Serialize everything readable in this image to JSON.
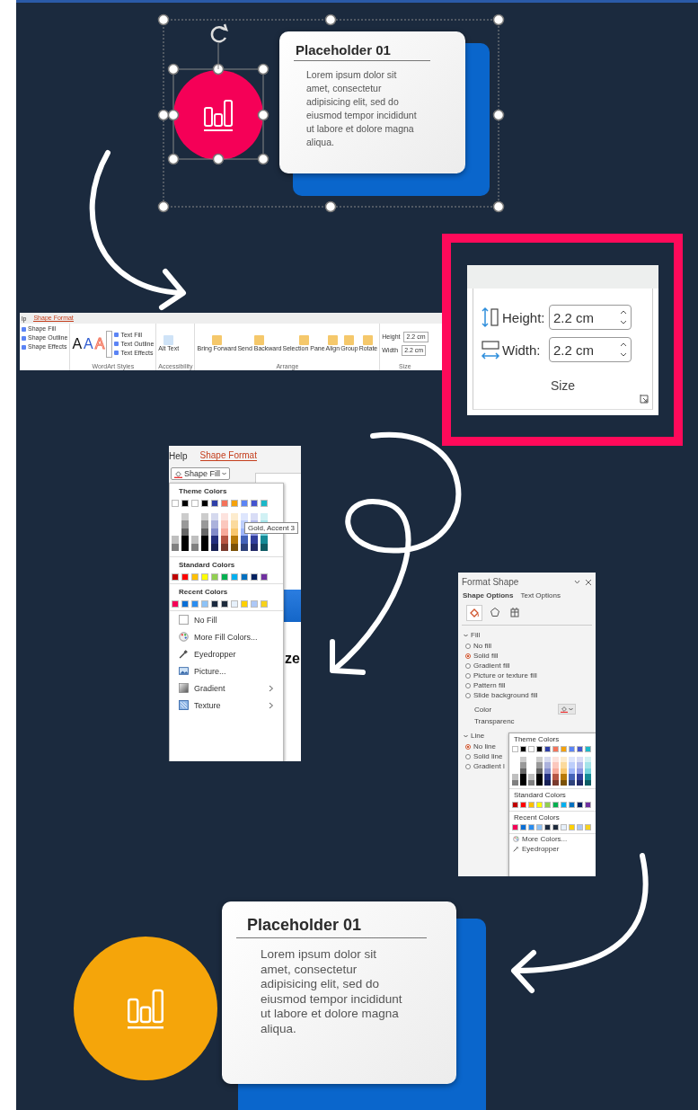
{
  "top_graphic": {
    "title": "Placeholder 01",
    "body": "Lorem ipsum dolor sit amet, consectetur adipisicing elit, sed do eiusmod tempor incididunt ut labore et dolore magna aliqua."
  },
  "ribbon": {
    "tabs": [
      {
        "label": "lp",
        "selected": false
      },
      {
        "label": "Shape Format",
        "selected": true
      }
    ],
    "shape_commands": [
      "Shape Fill",
      "Shape Outline",
      "Shape Effects"
    ],
    "wordart_letters": [
      "A",
      "A",
      "A"
    ],
    "text_commands": [
      "Text Fill",
      "Text Outline",
      "Text Effects"
    ],
    "alt_text": "Alt Text",
    "arrange_commands": [
      "Bring Forward",
      "Send Backward",
      "Selection Pane",
      "Align",
      "Group",
      "Rotate"
    ],
    "size_fields": [
      {
        "label": "Height",
        "value": "2.2 cm"
      },
      {
        "label": "Width",
        "value": "2.2 cm"
      }
    ],
    "group_labels": [
      "WordArt Styles",
      "Accessibility",
      "Arrange",
      "Size"
    ]
  },
  "size_panel": {
    "fields": [
      {
        "kind": "height",
        "label": "Height:",
        "value": "2.2 cm"
      },
      {
        "kind": "width",
        "label": "Width:",
        "value": "2.2 cm"
      }
    ],
    "group_label": "Size"
  },
  "shape_fill_menu": {
    "tabs": [
      {
        "label": "Help",
        "selected": false
      },
      {
        "label": "Shape Format",
        "selected": true
      }
    ],
    "button": "Shape Fill",
    "background_text": "ze",
    "theme_heading": "Theme Colors",
    "theme_colors": [
      {
        "color": "#ffffff"
      },
      {
        "color": "#000000"
      },
      {
        "color": "#ffffff"
      },
      {
        "color": "#000000"
      },
      {
        "color": "#2e3fa8"
      },
      {
        "color": "#f4735a"
      },
      {
        "color": "#f5a20b"
      },
      {
        "color": "#5b84f5"
      },
      {
        "color": "#4354d0"
      },
      {
        "color": "#1bb8c8"
      }
    ],
    "tooltip": "Gold, Accent 3",
    "standard_heading": "Standard Colors",
    "standard_colors": [
      {
        "color": "#c00000"
      },
      {
        "color": "#ff0000"
      },
      {
        "color": "#ffc000"
      },
      {
        "color": "#ffff00"
      },
      {
        "color": "#92d050"
      },
      {
        "color": "#00b050"
      },
      {
        "color": "#00b0f0"
      },
      {
        "color": "#0070c0"
      },
      {
        "color": "#002060"
      },
      {
        "color": "#7030a0"
      }
    ],
    "recent_heading": "Recent Colors",
    "recent_colors": [
      {
        "color": "#f50057"
      },
      {
        "color": "#0a6fd6"
      },
      {
        "color": "#2a8df0"
      },
      {
        "color": "#8ec3f7"
      },
      {
        "color": "#1b2a3f"
      },
      {
        "color": "#1e2b3c"
      },
      {
        "color": "#e6f0fb"
      },
      {
        "color": "#ffd000"
      },
      {
        "color": "#adc8f7"
      },
      {
        "color": "#f7d21c"
      }
    ],
    "items": [
      {
        "kind": "no-fill",
        "label": "No Fill",
        "has_submenu": false
      },
      {
        "kind": "palette",
        "label": "More Fill Colors...",
        "has_submenu": false
      },
      {
        "kind": "eyedropper",
        "label": "Eyedropper",
        "has_submenu": false
      },
      {
        "kind": "picture",
        "label": "Picture...",
        "has_submenu": false
      },
      {
        "kind": "gradient",
        "label": "Gradient",
        "has_submenu": true
      },
      {
        "kind": "texture",
        "label": "Texture",
        "has_submenu": true
      }
    ]
  },
  "format_shape_pane": {
    "title": "Format Shape",
    "option_tabs": [
      {
        "label": "Shape Options",
        "selected": true
      },
      {
        "label": "Text Options",
        "selected": false
      }
    ],
    "icon_tabs": [
      {
        "kind": "fill",
        "selected": true
      },
      {
        "kind": "effects",
        "selected": false
      },
      {
        "kind": "size",
        "selected": false
      }
    ],
    "fill_heading": "Fill",
    "fill_options": [
      {
        "label": "No fill",
        "selected": false
      },
      {
        "label": "Solid fill",
        "selected": true
      },
      {
        "label": "Gradient fill",
        "selected": false
      },
      {
        "label": "Picture or texture fill",
        "selected": false
      },
      {
        "label": "Pattern fill",
        "selected": false
      },
      {
        "label": "Slide background fill",
        "selected": false
      }
    ],
    "color_label": "Color",
    "transparency_label": "Transparenc",
    "line_heading": "Line",
    "line_options": [
      {
        "label": "No line",
        "selected": true
      },
      {
        "label": "Solid line",
        "selected": false
      },
      {
        "label": "Gradient l",
        "selected": false
      }
    ],
    "dropdown": {
      "theme_heading": "Theme Colors",
      "theme_colors": [
        {
          "color": "#ffffff"
        },
        {
          "color": "#000000"
        },
        {
          "color": "#ffffff"
        },
        {
          "color": "#000000"
        },
        {
          "color": "#2e3fa8"
        },
        {
          "color": "#f4735a"
        },
        {
          "color": "#f5a20b"
        },
        {
          "color": "#5b84f5"
        },
        {
          "color": "#4354d0"
        },
        {
          "color": "#1bb8c8"
        }
      ],
      "standard_heading": "Standard Colors",
      "standard_colors": [
        {
          "color": "#c00000"
        },
        {
          "color": "#ff0000"
        },
        {
          "color": "#ffc000"
        },
        {
          "color": "#ffff00"
        },
        {
          "color": "#92d050"
        },
        {
          "color": "#00b050"
        },
        {
          "color": "#00b0f0"
        },
        {
          "color": "#0070c0"
        },
        {
          "color": "#002060"
        },
        {
          "color": "#7030a0"
        }
      ],
      "recent_heading": "Recent Colors",
      "recent_colors": [
        {
          "color": "#f50057"
        },
        {
          "color": "#0a6fd6"
        },
        {
          "color": "#2a8df0"
        },
        {
          "color": "#8ec3f7"
        },
        {
          "color": "#1b2a3f"
        },
        {
          "color": "#1e2b3c"
        },
        {
          "color": "#e6f0fb"
        },
        {
          "color": "#ffd000"
        },
        {
          "color": "#adc8f7"
        },
        {
          "color": "#f7d21c"
        }
      ],
      "items": [
        {
          "kind": "palette",
          "label": "More Colors..."
        },
        {
          "kind": "eyedropper",
          "label": "Eyedropper"
        }
      ]
    }
  },
  "final_graphic": {
    "title": "Placeholder 01",
    "body": "Lorem ipsum dolor sit amet, consectetur adipisicing elit, sed do eiusmod tempor incididunt ut labore et dolore magna aliqua."
  }
}
